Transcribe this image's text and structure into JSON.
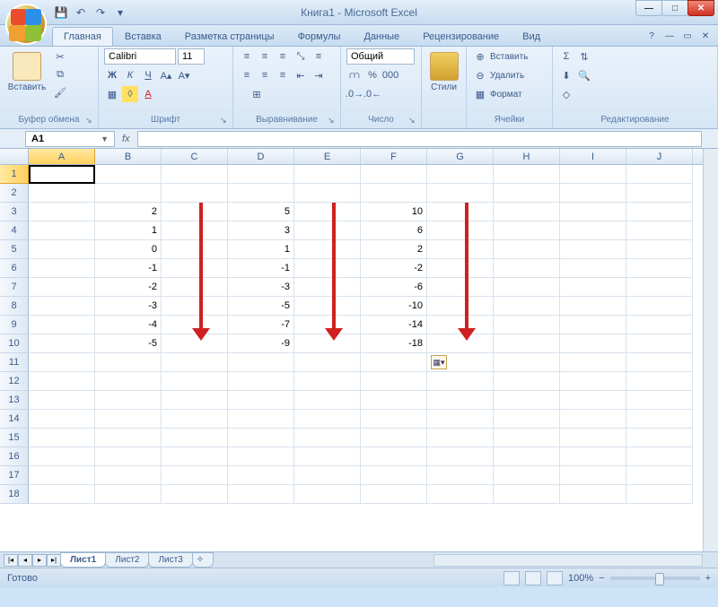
{
  "title": "Книга1 - Microsoft Excel",
  "qat": {
    "save": "💾",
    "undo": "↶",
    "redo": "↷"
  },
  "tabs": {
    "home": "Главная",
    "insert": "Вставка",
    "layout": "Разметка страницы",
    "formulas": "Формулы",
    "data": "Данные",
    "review": "Рецензирование",
    "view": "Вид"
  },
  "ribbon": {
    "clipboard": {
      "paste": "Вставить",
      "label": "Буфер обмена"
    },
    "font": {
      "name": "Calibri",
      "size": "11",
      "bold": "Ж",
      "italic": "К",
      "underline": "Ч",
      "label": "Шрифт"
    },
    "align": {
      "label": "Выравнивание",
      "wrap": "≡",
      "merge": "⊞"
    },
    "number": {
      "format": "Общий",
      "currency": "⩋",
      "percent": "%",
      "comma": "000",
      "inc": ",0←",
      "dec": ",0→",
      "label": "Число"
    },
    "styles": {
      "btn": "Стили",
      "label": ""
    },
    "cells": {
      "insert": "Вставить",
      "delete": "Удалить",
      "format": "Формат",
      "label": "Ячейки"
    },
    "editing": {
      "sum": "Σ",
      "fill": "⬇",
      "clear": "◇",
      "sort": "⇅",
      "find": "🔍",
      "label": "Редактирование"
    }
  },
  "namebox": "A1",
  "columns": [
    "A",
    "B",
    "C",
    "D",
    "E",
    "F",
    "G",
    "H",
    "I",
    "J"
  ],
  "row_count": 18,
  "chart_data": {
    "type": "table",
    "note": "Spreadsheet numeric content; three autofilled columns B, D, F rows 3–10",
    "cells": {
      "B3": 2,
      "B4": 1,
      "B5": 0,
      "B6": -1,
      "B7": -2,
      "B8": -3,
      "B9": -4,
      "B10": -5,
      "D3": 5,
      "D4": 3,
      "D5": 1,
      "D6": -1,
      "D7": -3,
      "D8": -5,
      "D9": -7,
      "D10": -9,
      "F3": 10,
      "F4": 6,
      "F5": 2,
      "F6": -2,
      "F7": -6,
      "F8": -10,
      "F9": -14,
      "F10": -18
    }
  },
  "sheets": {
    "s1": "Лист1",
    "s2": "Лист2",
    "s3": "Лист3"
  },
  "status": {
    "ready": "Готово",
    "zoom": "100%"
  }
}
